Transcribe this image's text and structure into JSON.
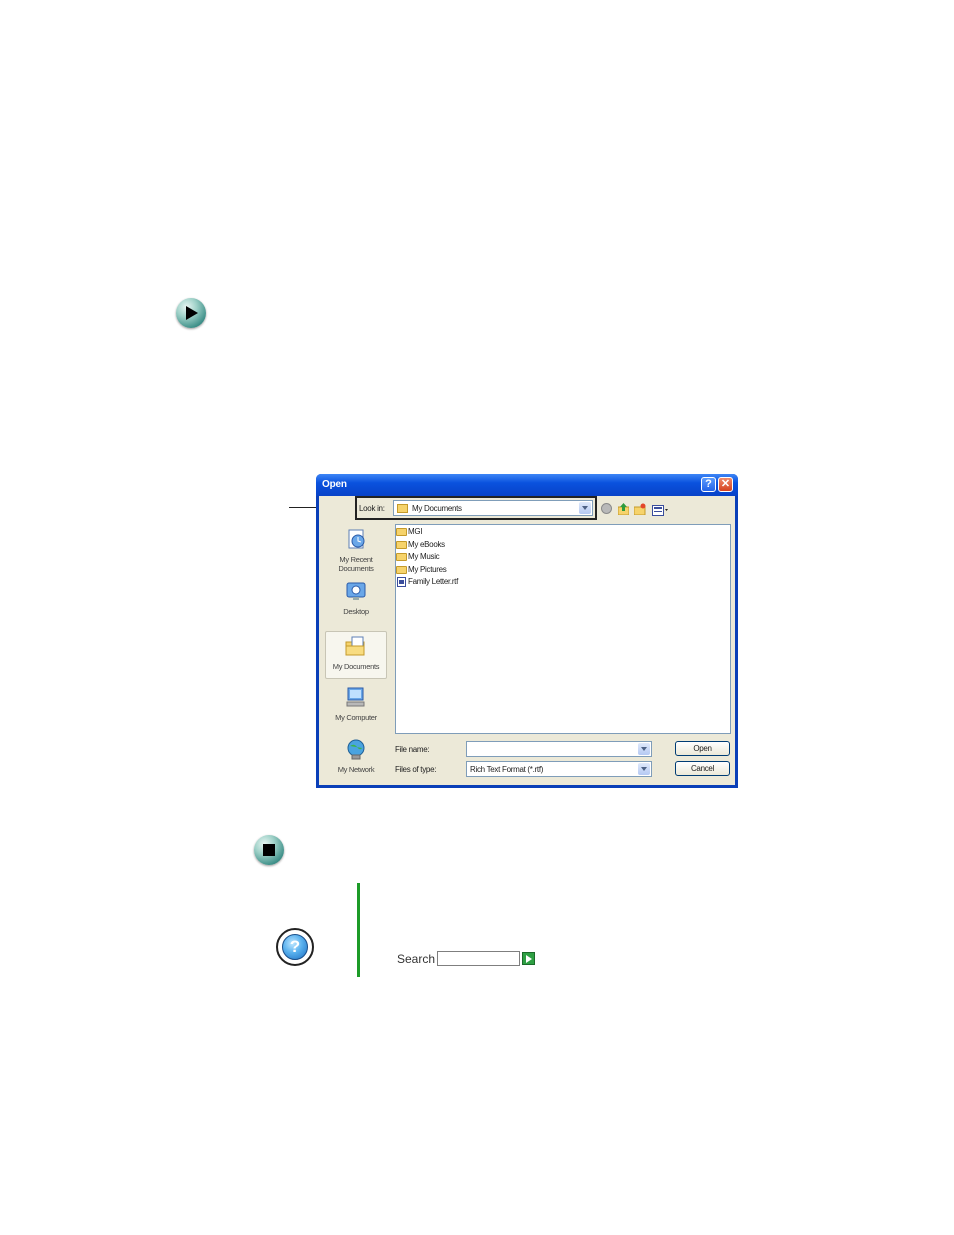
{
  "dialog": {
    "title": "Open",
    "help_button": "?",
    "close_button": "✕",
    "look_in": {
      "label": "Look in:",
      "value": "My Documents"
    },
    "places": [
      {
        "label_line1": "My Recent",
        "label_line2": "Documents",
        "icon": "recent-documents-icon"
      },
      {
        "label_line1": "Desktop",
        "label_line2": "",
        "icon": "desktop-icon"
      },
      {
        "label_line1": "My Documents",
        "label_line2": "",
        "icon": "my-documents-icon",
        "selected": true
      },
      {
        "label_line1": "My Computer",
        "label_line2": "",
        "icon": "my-computer-icon"
      },
      {
        "label_line1": "My Network",
        "label_line2": "",
        "icon": "my-network-icon"
      }
    ],
    "files": [
      {
        "name": "MGI",
        "type": "folder"
      },
      {
        "name": "My eBooks",
        "type": "folder"
      },
      {
        "name": "My Music",
        "type": "folder"
      },
      {
        "name": "My Pictures",
        "type": "folder"
      },
      {
        "name": "Family Letter.rtf",
        "type": "document"
      }
    ],
    "file_name": {
      "label": "File name:",
      "value": ""
    },
    "files_of_type": {
      "label": "Files of type:",
      "value": "Rich Text Format (*.rtf)"
    },
    "open_button": "Open",
    "cancel_button": "Cancel"
  },
  "help_panel": {
    "search_label": "Search",
    "search_value": ""
  }
}
